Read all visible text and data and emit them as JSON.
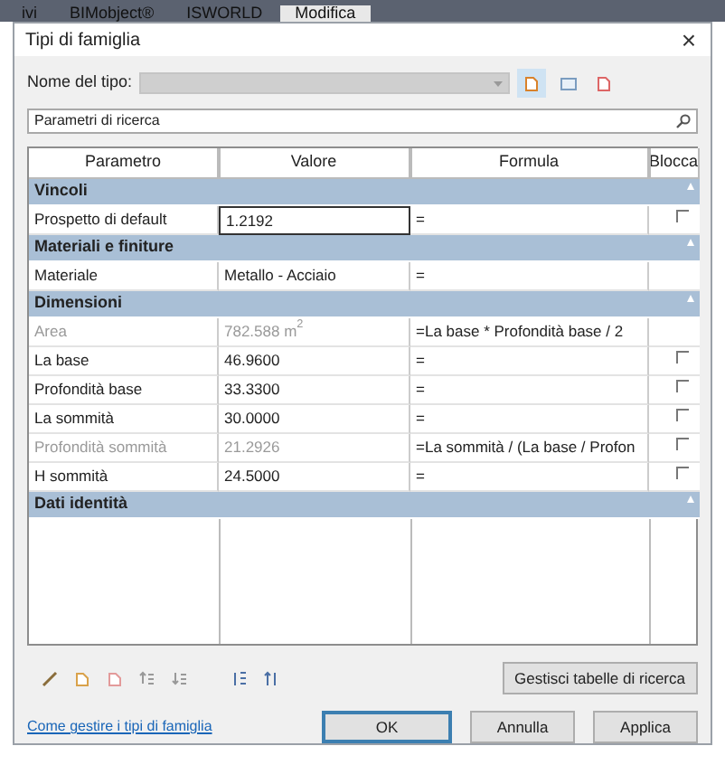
{
  "ribbon_tabs": [
    {
      "label": "ivi",
      "selected": false
    },
    {
      "label": "BIMobject®",
      "selected": false
    },
    {
      "label": "ISWORLD",
      "selected": false
    },
    {
      "label": "Modifica",
      "selected": true
    }
  ],
  "window": {
    "title": "Tipi di famiglia",
    "close": "×"
  },
  "type_name": {
    "label": "Nome del tipo:",
    "disabled": true
  },
  "search": {
    "placeholder": "Parametri di ricerca"
  },
  "table": {
    "columns": [
      "Parametro",
      "Valore",
      "Formula",
      "Blocca"
    ],
    "rows": [
      {
        "kind": "group",
        "label": "Vincoli"
      },
      {
        "kind": "param",
        "name": "Prospetto di default",
        "value": "1.2192",
        "formula": "=",
        "editing": true,
        "disabled": false,
        "locked": false
      },
      {
        "kind": "group",
        "label": "Materiali e finiture"
      },
      {
        "kind": "param",
        "name": "Materiale",
        "value": "Metallo - Acciaio",
        "formula": "=",
        "editing": false,
        "disabled": false
      },
      {
        "kind": "group",
        "label": "Dimensioni"
      },
      {
        "kind": "param",
        "name": "Area",
        "value": "782.588 m$^{2}$",
        "formula": "=La base * Profondità base / 2",
        "editing": false,
        "disabled": true
      },
      {
        "kind": "param",
        "name": "La base",
        "value": "46.9600",
        "formula": "=",
        "editing": false,
        "disabled": false,
        "locked": false
      },
      {
        "kind": "param",
        "name": "Profondità base",
        "value": "33.3300",
        "formula": "=",
        "editing": false,
        "disabled": false,
        "locked": false
      },
      {
        "kind": "param",
        "name": "La sommità",
        "value": "30.0000",
        "formula": "=",
        "editing": false,
        "disabled": false,
        "locked": false
      },
      {
        "kind": "param",
        "name": "Profondità sommità",
        "value": "21.2926",
        "formula": "=La sommità / (La base / Profon",
        "editing": false,
        "disabled": true,
        "locked": false
      },
      {
        "kind": "param",
        "name": "H sommità",
        "value": "24.5000",
        "formula": "=",
        "editing": false,
        "disabled": false,
        "locked": false
      },
      {
        "kind": "group",
        "label": "Dati identità"
      }
    ]
  },
  "lookup_button": "Gestisci tabelle di ricerca",
  "help_link": "Come gestire i tipi di famiglia",
  "buttons": [
    {
      "label": "OK",
      "default": true
    },
    {
      "label": "Annulla",
      "default": false
    },
    {
      "label": "Applica",
      "default": false
    }
  ]
}
